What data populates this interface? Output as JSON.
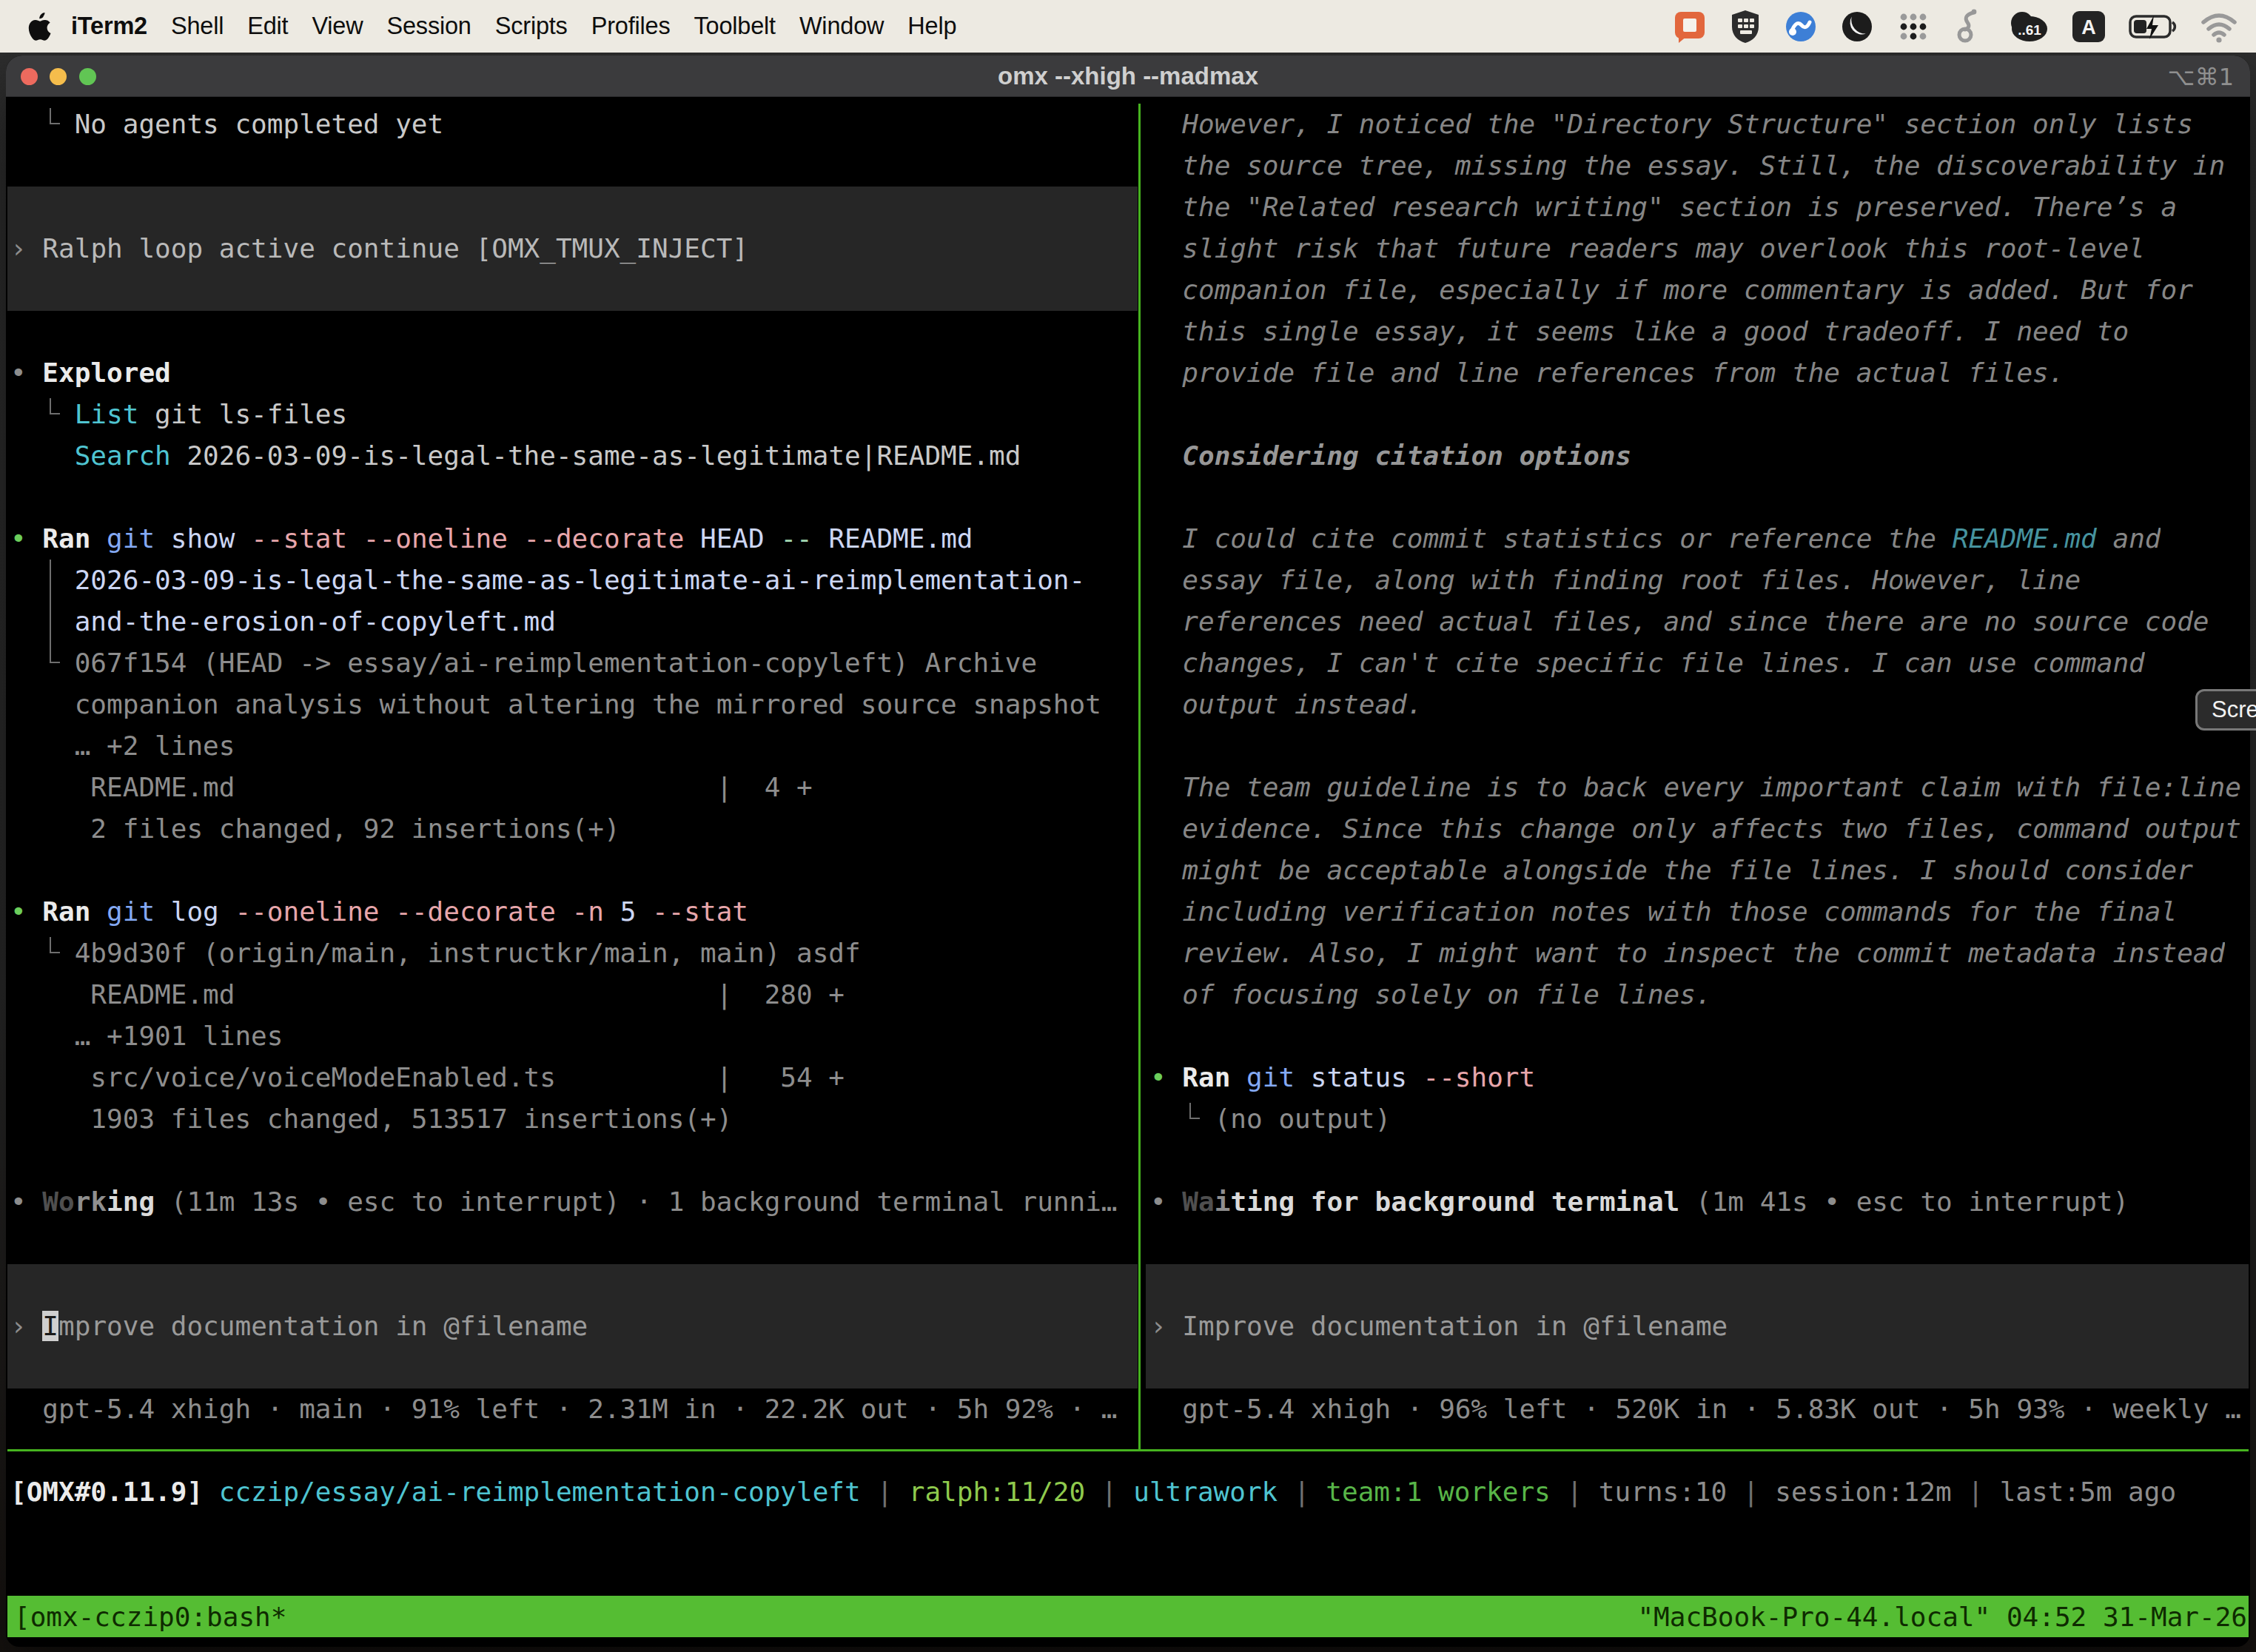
{
  "menu_bar": {
    "apple_icon": "apple-icon",
    "items": [
      "iTerm2",
      "Shell",
      "Edit",
      "View",
      "Session",
      "Scripts",
      "Profiles",
      "Toolbelt",
      "Window",
      "Help"
    ],
    "status_icons": [
      "chat-app-icon",
      "shield-keyboard-icon",
      "sync-blue-icon",
      "moon-circle-icon",
      "dots-grid-icon",
      "dragon-vpn-icon",
      "battery-percent-badge-icon",
      "input-source-icon",
      "battery-charging-icon",
      "wifi-icon"
    ],
    "battery_badge_text": "..61",
    "input_source_letter": "A"
  },
  "window": {
    "title": "omx --xhigh --madmax",
    "shortcut": "⌥⌘1"
  },
  "palette": {
    "bright": "#c9c9c9",
    "mid": "#b9b9b9",
    "dim": "#8d8d8d",
    "think": "#868686",
    "thinkhead": "#979797",
    "white": "#ebebeb",
    "cyan": "#4fc4d1",
    "teal": "#46939f",
    "blue": "#84a9f3",
    "pink": "#e7a6ab",
    "lav": "#ccd6f3",
    "mint": "#a5d9b3",
    "green": "#6cce5b",
    "lime": "#8fca4d",
    "teamgreen": "#58b548",
    "sep": "#707070",
    "sh1": "#4f4f4f",
    "sh2": "#8f8f8f",
    "sh3": "#dadada",
    "input": "#9a9a9a",
    "cursor": "cursor"
  },
  "left_pane": {
    "boxes": [
      {
        "row": 2,
        "span": 3
      },
      {
        "row": 28,
        "span": 3
      }
    ],
    "guides": [
      {
        "row": 0,
        "col": 2
      },
      {
        "row": 7,
        "col": 2
      },
      {
        "row": 13,
        "col": 2,
        "from": 11
      },
      {
        "row": 20,
        "col": 2
      }
    ],
    "rows": [
      {
        "r": 0,
        "segs": [
          [
            "bright",
            "    No agents completed yet"
          ]
        ]
      },
      {
        "r": 3,
        "segs": [
          [
            "dim",
            "› "
          ],
          [
            "mid",
            "Ralph loop active continue [OMX_TMUX_INJECT]"
          ]
        ]
      },
      {
        "r": 6,
        "segs": [
          [
            "dim",
            "• "
          ],
          [
            "white",
            "Explored",
            "b"
          ]
        ]
      },
      {
        "r": 7,
        "segs": [
          [
            "cyan",
            "    List"
          ],
          [
            "bright",
            " git ls-files"
          ]
        ]
      },
      {
        "r": 8,
        "segs": [
          [
            "cyan",
            "    Search"
          ],
          [
            "bright",
            " 2026-03-09-is-legal-the-same-as-legitimate|README.md"
          ]
        ]
      },
      {
        "r": 10,
        "segs": [
          [
            "green",
            "• "
          ],
          [
            "white",
            "Ran",
            "b"
          ],
          [
            "blue",
            " git"
          ],
          [
            "lav",
            " show"
          ],
          [
            "pink",
            " --stat --oneline --decorate"
          ],
          [
            "lav",
            " HEAD"
          ],
          [
            "mint",
            " --"
          ],
          [
            "lav",
            " README.md"
          ]
        ]
      },
      {
        "r": 11,
        "segs": [
          [
            "lav",
            "    2026-03-09-is-legal-the-same-as-legitimate-ai-reimplementation-"
          ]
        ]
      },
      {
        "r": 12,
        "segs": [
          [
            "lav",
            "    and-the-erosion-of-copyleft.md"
          ]
        ]
      },
      {
        "r": 13,
        "segs": [
          [
            "dim",
            "    067f154 (HEAD -> essay/ai-reimplementation-copyleft) Archive"
          ]
        ]
      },
      {
        "r": 14,
        "segs": [
          [
            "dim",
            "    companion analysis without altering the mirrored source snapshot"
          ]
        ]
      },
      {
        "r": 15,
        "segs": [
          [
            "dim",
            "    … +2 lines"
          ]
        ]
      },
      {
        "r": 16,
        "segs": [
          [
            "dim",
            "     README.md                              |  4 +"
          ]
        ]
      },
      {
        "r": 17,
        "segs": [
          [
            "dim",
            "     2 files changed, 92 insertions(+)"
          ]
        ]
      },
      {
        "r": 19,
        "segs": [
          [
            "green",
            "• "
          ],
          [
            "white",
            "Ran",
            "b"
          ],
          [
            "blue",
            " git"
          ],
          [
            "lav",
            " log"
          ],
          [
            "pink",
            " --oneline --decorate -n"
          ],
          [
            "lav",
            " 5"
          ],
          [
            "pink",
            " --stat"
          ]
        ]
      },
      {
        "r": 20,
        "segs": [
          [
            "dim",
            "    4b9d30f (origin/main, instructkr/main, main) asdf"
          ]
        ]
      },
      {
        "r": 21,
        "segs": [
          [
            "dim",
            "     README.md                              |  280 +"
          ]
        ]
      },
      {
        "r": 22,
        "segs": [
          [
            "dim",
            "    … +1901 lines"
          ]
        ]
      },
      {
        "r": 23,
        "segs": [
          [
            "dim",
            "     src/voice/voiceModeEnabled.ts          |   54 +"
          ]
        ]
      },
      {
        "r": 24,
        "segs": [
          [
            "dim",
            "     1903 files changed, 513517 insertions(+)"
          ]
        ]
      },
      {
        "r": 26,
        "segs": [
          [
            "dim",
            "• "
          ],
          [
            "sh1",
            "Wo",
            "b"
          ],
          [
            "sh2",
            "rk",
            "b"
          ],
          [
            "sh3",
            "ing",
            "b"
          ],
          [
            "dim",
            " (11m 13s • esc to interrupt) · 1 background terminal runni…"
          ]
        ]
      },
      {
        "r": 29,
        "segs": [
          [
            "dim",
            "› "
          ],
          [
            "cursor",
            "I"
          ],
          [
            "input",
            "mprove documentation in @filename"
          ]
        ]
      },
      {
        "r": 31,
        "segs": [
          [
            "dim",
            "  gpt-5.4 xhigh · main · 91% left · 2.31M in · 22.2K out · 5h 92% · …"
          ]
        ]
      }
    ]
  },
  "right_pane": {
    "boxes": [
      {
        "row": 28,
        "span": 3
      }
    ],
    "guides": [
      {
        "row": 24,
        "col": 2
      }
    ],
    "rows": [
      {
        "r": 0,
        "segs": [
          [
            "think",
            "  However, I noticed the \"Directory Structure\" section only lists",
            "i"
          ]
        ]
      },
      {
        "r": 1,
        "segs": [
          [
            "think",
            "  the source tree, missing the essay. Still, the discoverability in",
            "i"
          ]
        ]
      },
      {
        "r": 2,
        "segs": [
          [
            "think",
            "  the \"Related research writing\" section is preserved. There’s a",
            "i"
          ]
        ]
      },
      {
        "r": 3,
        "segs": [
          [
            "think",
            "  slight risk that future readers may overlook this root-level",
            "i"
          ]
        ]
      },
      {
        "r": 4,
        "segs": [
          [
            "think",
            "  companion file, especially if more commentary is added. But for",
            "i"
          ]
        ]
      },
      {
        "r": 5,
        "segs": [
          [
            "think",
            "  this single essay, it seems like a good tradeoff. I need to",
            "i"
          ]
        ]
      },
      {
        "r": 6,
        "segs": [
          [
            "think",
            "  provide file and line references from the actual files.",
            "i"
          ]
        ]
      },
      {
        "r": 8,
        "segs": [
          [
            "thinkhead",
            "  Considering citation options",
            "bi"
          ]
        ]
      },
      {
        "r": 10,
        "segs": [
          [
            "think",
            "  I could cite commit statistics or reference the ",
            "i"
          ],
          [
            "teal",
            "README.md",
            "i"
          ],
          [
            "think",
            " and",
            "i"
          ]
        ]
      },
      {
        "r": 11,
        "segs": [
          [
            "think",
            "  essay file, along with finding root files. However, line",
            "i"
          ]
        ]
      },
      {
        "r": 12,
        "segs": [
          [
            "think",
            "  references need actual files, and since there are no source code",
            "i"
          ]
        ]
      },
      {
        "r": 13,
        "segs": [
          [
            "think",
            "  changes, I can't cite specific file lines. I can use command",
            "i"
          ]
        ]
      },
      {
        "r": 14,
        "segs": [
          [
            "think",
            "  output instead.",
            "i"
          ]
        ]
      },
      {
        "r": 16,
        "segs": [
          [
            "think",
            "  The team guideline is to back every important claim with file:line",
            "i"
          ]
        ]
      },
      {
        "r": 17,
        "segs": [
          [
            "think",
            "  evidence. Since this change only affects two files, command output",
            "i"
          ]
        ]
      },
      {
        "r": 18,
        "segs": [
          [
            "think",
            "  might be acceptable alongside the file lines. I should consider",
            "i"
          ]
        ]
      },
      {
        "r": 19,
        "segs": [
          [
            "think",
            "  including verification notes with those commands for the final",
            "i"
          ]
        ]
      },
      {
        "r": 20,
        "segs": [
          [
            "think",
            "  review. Also, I might want to inspect the commit metadata instead",
            "i"
          ]
        ]
      },
      {
        "r": 21,
        "segs": [
          [
            "think",
            "  of focusing solely on file lines.",
            "i"
          ]
        ]
      },
      {
        "r": 23,
        "segs": [
          [
            "green",
            "• "
          ],
          [
            "white",
            "Ran",
            "b"
          ],
          [
            "blue",
            " git"
          ],
          [
            "lav",
            " status"
          ],
          [
            "pink",
            " --short"
          ]
        ]
      },
      {
        "r": 24,
        "segs": [
          [
            "dim",
            "    (no output)"
          ]
        ]
      },
      {
        "r": 26,
        "segs": [
          [
            "dim",
            "• "
          ],
          [
            "sh1",
            "Wa",
            "b"
          ],
          [
            "sh2",
            "i",
            "b"
          ],
          [
            "sh3",
            "ting for background terminal",
            "b"
          ],
          [
            "dim",
            " (1m 41s • esc to interrupt)"
          ]
        ]
      },
      {
        "r": 29,
        "segs": [
          [
            "dim",
            "› "
          ],
          [
            "input",
            "Improve documentation in @filename"
          ]
        ]
      },
      {
        "r": 31,
        "segs": [
          [
            "dim",
            "  gpt-5.4 xhigh · 96% left · 520K in · 5.83K out · 5h 93% · weekly …"
          ]
        ]
      }
    ]
  },
  "status_row": {
    "r": 33,
    "segs": [
      [
        "white",
        "[OMX#0.11.9]",
        "b"
      ],
      [
        "cyan",
        " cczip/essay/ai-reimplementation-copyleft"
      ],
      [
        "sep",
        " | "
      ],
      [
        "lime",
        "ralph:11/20"
      ],
      [
        "sep",
        " | "
      ],
      [
        "cyan",
        "ultrawork"
      ],
      [
        "sep",
        " | "
      ],
      [
        "teamgreen",
        "team:1 workers"
      ],
      [
        "sep",
        " | "
      ],
      [
        "dim",
        "turns:10"
      ],
      [
        "sep",
        " | "
      ],
      [
        "dim",
        "session:12m"
      ],
      [
        "sep",
        " | "
      ],
      [
        "dim",
        "last:5m ago"
      ]
    ]
  },
  "tmux_bar": {
    "left": "[omx-cczip0:bash*",
    "right": "\"MacBook-Pro-44.local\" 04:52 31-Mar-26"
  },
  "screen_button": {
    "label": "Scre"
  }
}
